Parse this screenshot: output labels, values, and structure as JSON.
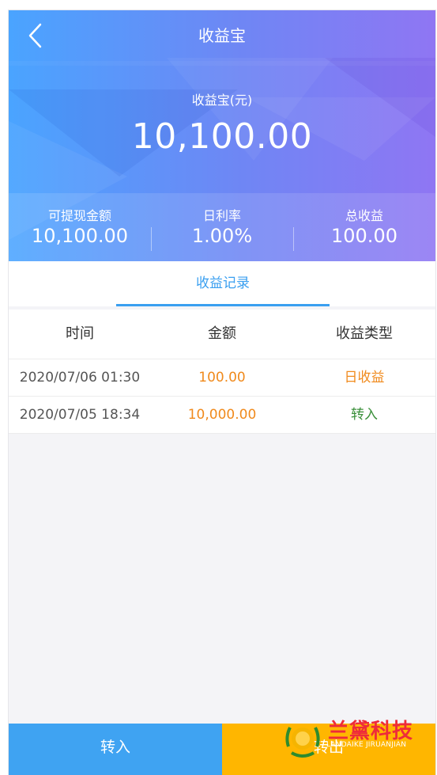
{
  "header": {
    "title": "收益宝"
  },
  "summary": {
    "balance_label": "收益宝(元)",
    "balance_value": "10,100.00",
    "stats": [
      {
        "label": "可提现金额",
        "value": "10,100.00"
      },
      {
        "label": "日利率",
        "value": "1.00%"
      },
      {
        "label": "总收益",
        "value": "100.00"
      }
    ]
  },
  "tabs": [
    {
      "label": "收益记录",
      "active": true
    }
  ],
  "records": {
    "columns": [
      "时间",
      "金额",
      "收益类型"
    ],
    "rows": [
      {
        "time": "2020/07/06 01:30",
        "amount": "100.00",
        "type": "日收益",
        "type_color": "#f08a1c"
      },
      {
        "time": "2020/07/05 18:34",
        "amount": "10,000.00",
        "type": "转入",
        "type_color": "#3a8f3a"
      }
    ]
  },
  "actions": {
    "in_label": "转入",
    "out_label": "转出"
  },
  "watermark": {
    "text": "兰黛科技",
    "subtext": "LANDAIKE JIRUANJIAN"
  },
  "colors": {
    "accent": "#3a9ff0",
    "amount": "#f08a1c",
    "transfer_out": "#ffb600"
  }
}
